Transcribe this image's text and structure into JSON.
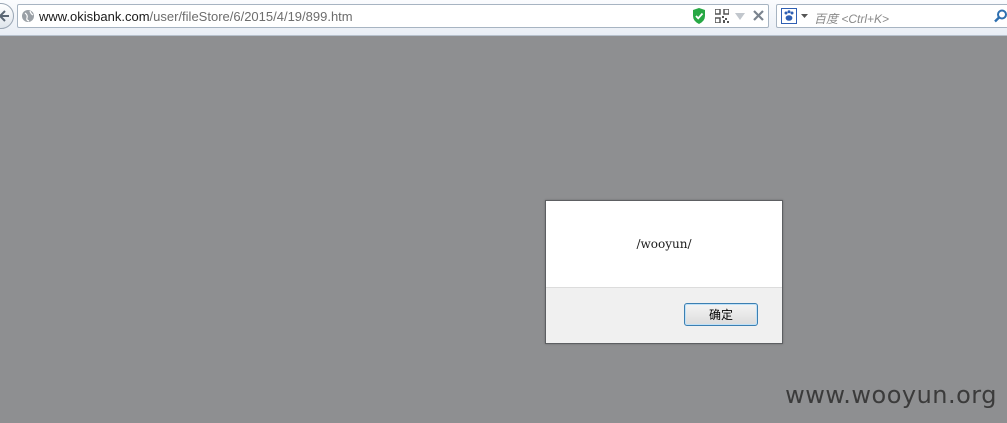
{
  "browser": {
    "url_host": "www.okisbank.com",
    "url_path": "/user/fileStore/6/2015/4/19/899.htm",
    "search_placeholder": "百度 <Ctrl+K>"
  },
  "icons": {
    "back": "back-arrow-icon",
    "site": "globe-icon",
    "security": "shield-check-icon",
    "qr": "qr-code-icon",
    "dropdown": "dropdown-arrow-icon",
    "close": "close-icon",
    "search_engine": "baidu-paw-icon",
    "search": "magnifier-icon"
  },
  "dialog": {
    "message": "/wooyun/",
    "ok_label": "确定"
  },
  "watermark": "www.wooyun.org",
  "colors": {
    "page_background": "#8e8f91",
    "shield": "#27a844",
    "ok_border": "#3c7fb1"
  }
}
